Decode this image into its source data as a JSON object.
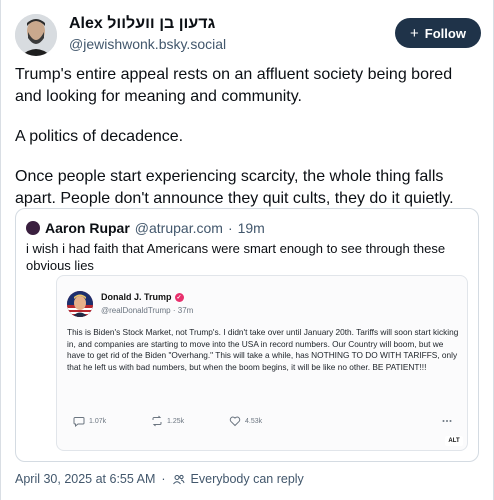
{
  "post": {
    "author_name": "Alex גדעון בן וועלוול",
    "author_handle": "@jewishwonk.bsky.social",
    "follow_label": "Follow",
    "paragraphs": [
      "Trump's entire appeal rests on an affluent society being bored and looking for meaning and community.",
      "A politics of decadence.",
      "Once people start experiencing scarcity, the whole thing falls apart. People don't announce they quit cults, they do it quietly."
    ],
    "date": "April 30, 2025 at 6:55 AM",
    "separator": "·",
    "reply_setting": "Everybody can reply"
  },
  "quote": {
    "author_name": "Aaron Rupar",
    "author_handle": "@atrupar.com",
    "separator": "·",
    "time": "19m",
    "text": "i wish i had faith that Americans were smart enough to see through these obvious lies",
    "media": {
      "name": "Donald J. Trump",
      "handle": "@realDonaldTrump · 37m",
      "text": "This is Biden's Stock Market, not Trump's. I didn't take over until January 20th. Tariffs will soon start kicking in, and companies are starting to move into the USA in record numbers. Our Country will boom, but we have to get rid of the Biden \"Overhang.\" This will take a while, has NOTHING TO DO WITH TARIFFS, only that he left us with bad numbers, but when the boom begins, it will be like no other. BE PATIENT!!!",
      "replies": "1.07k",
      "reposts": "1.25k",
      "likes": "4.53k",
      "alt_label": "ALT"
    }
  },
  "colors": {
    "follow_bg": "#1f3349",
    "muted_text": "#42576c",
    "verified": "#e8306d"
  }
}
